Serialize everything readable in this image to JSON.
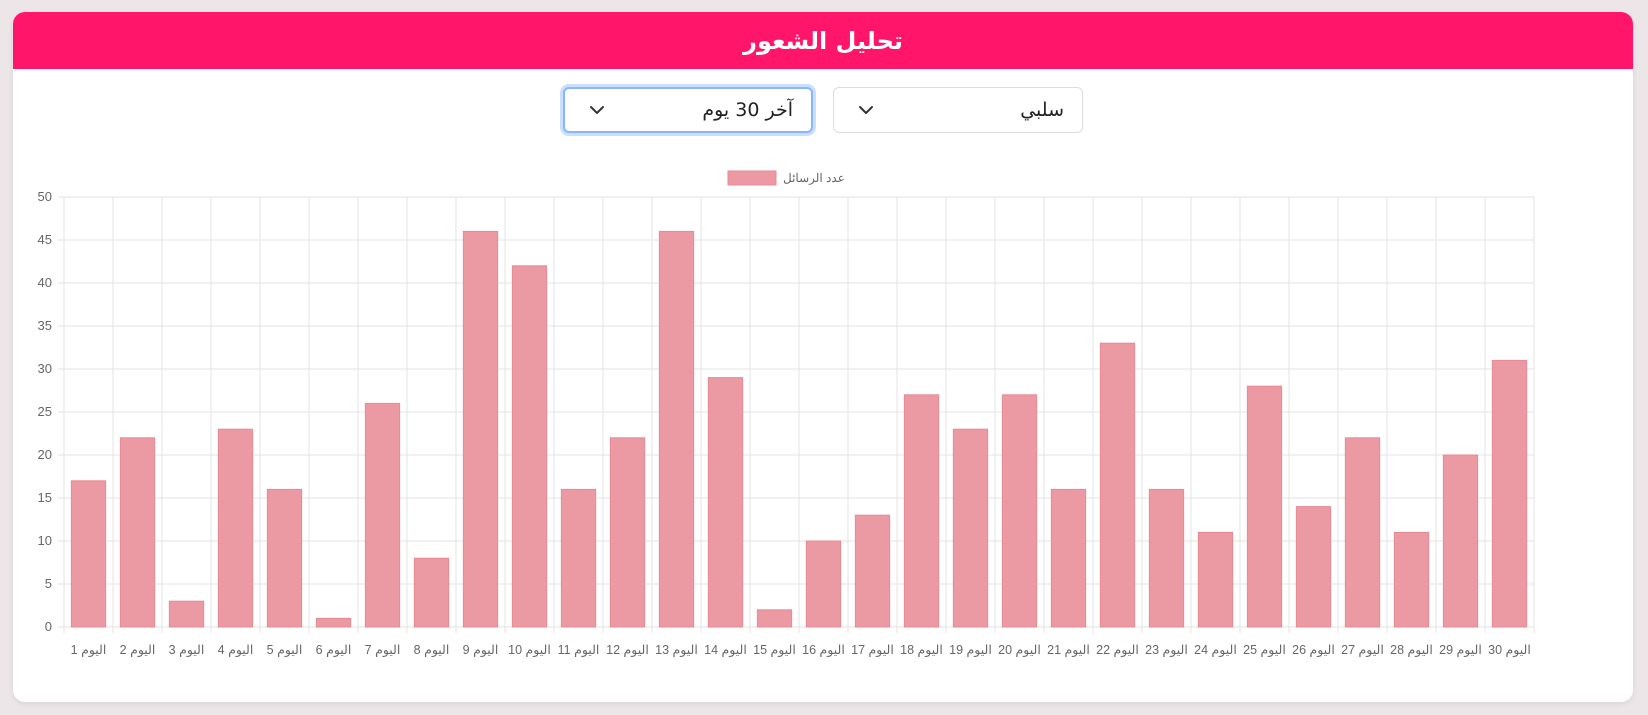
{
  "header": {
    "title": "تحليل الشعور"
  },
  "filters": {
    "sentiment": {
      "selected": "سلبي"
    },
    "period": {
      "selected": "آخر 30 يوم"
    }
  },
  "colors": {
    "header": "#ff1569",
    "bar_fill": "#eb9aa3",
    "bar_stroke": "#e88993",
    "grid": "#e3e3e3",
    "tick": "#666666"
  },
  "chart_data": {
    "type": "bar",
    "legend": {
      "label": "عدد الرسائل",
      "position": "top"
    },
    "categories": [
      "اليوم 1",
      "اليوم 2",
      "اليوم 3",
      "اليوم 4",
      "اليوم 5",
      "اليوم 6",
      "اليوم 7",
      "اليوم 8",
      "اليوم 9",
      "اليوم 10",
      "اليوم 11",
      "اليوم 12",
      "اليوم 13",
      "اليوم 14",
      "اليوم 15",
      "اليوم 16",
      "اليوم 17",
      "اليوم 18",
      "اليوم 19",
      "اليوم 20",
      "اليوم 21",
      "اليوم 22",
      "اليوم 23",
      "اليوم 24",
      "اليوم 25",
      "اليوم 26",
      "اليوم 27",
      "اليوم 28",
      "اليوم 29",
      "اليوم 30"
    ],
    "series": [
      {
        "name": "عدد الرسائل",
        "values": [
          17,
          22,
          3,
          23,
          16,
          1,
          26,
          8,
          46,
          42,
          16,
          22,
          46,
          29,
          2,
          10,
          13,
          27,
          23,
          27,
          16,
          33,
          16,
          11,
          28,
          14,
          22,
          11,
          20,
          31
        ]
      }
    ],
    "ylim": [
      0,
      50
    ],
    "yticks": [
      0,
      5,
      10,
      15,
      20,
      25,
      30,
      35,
      40,
      45,
      50
    ],
    "grid": true
  }
}
